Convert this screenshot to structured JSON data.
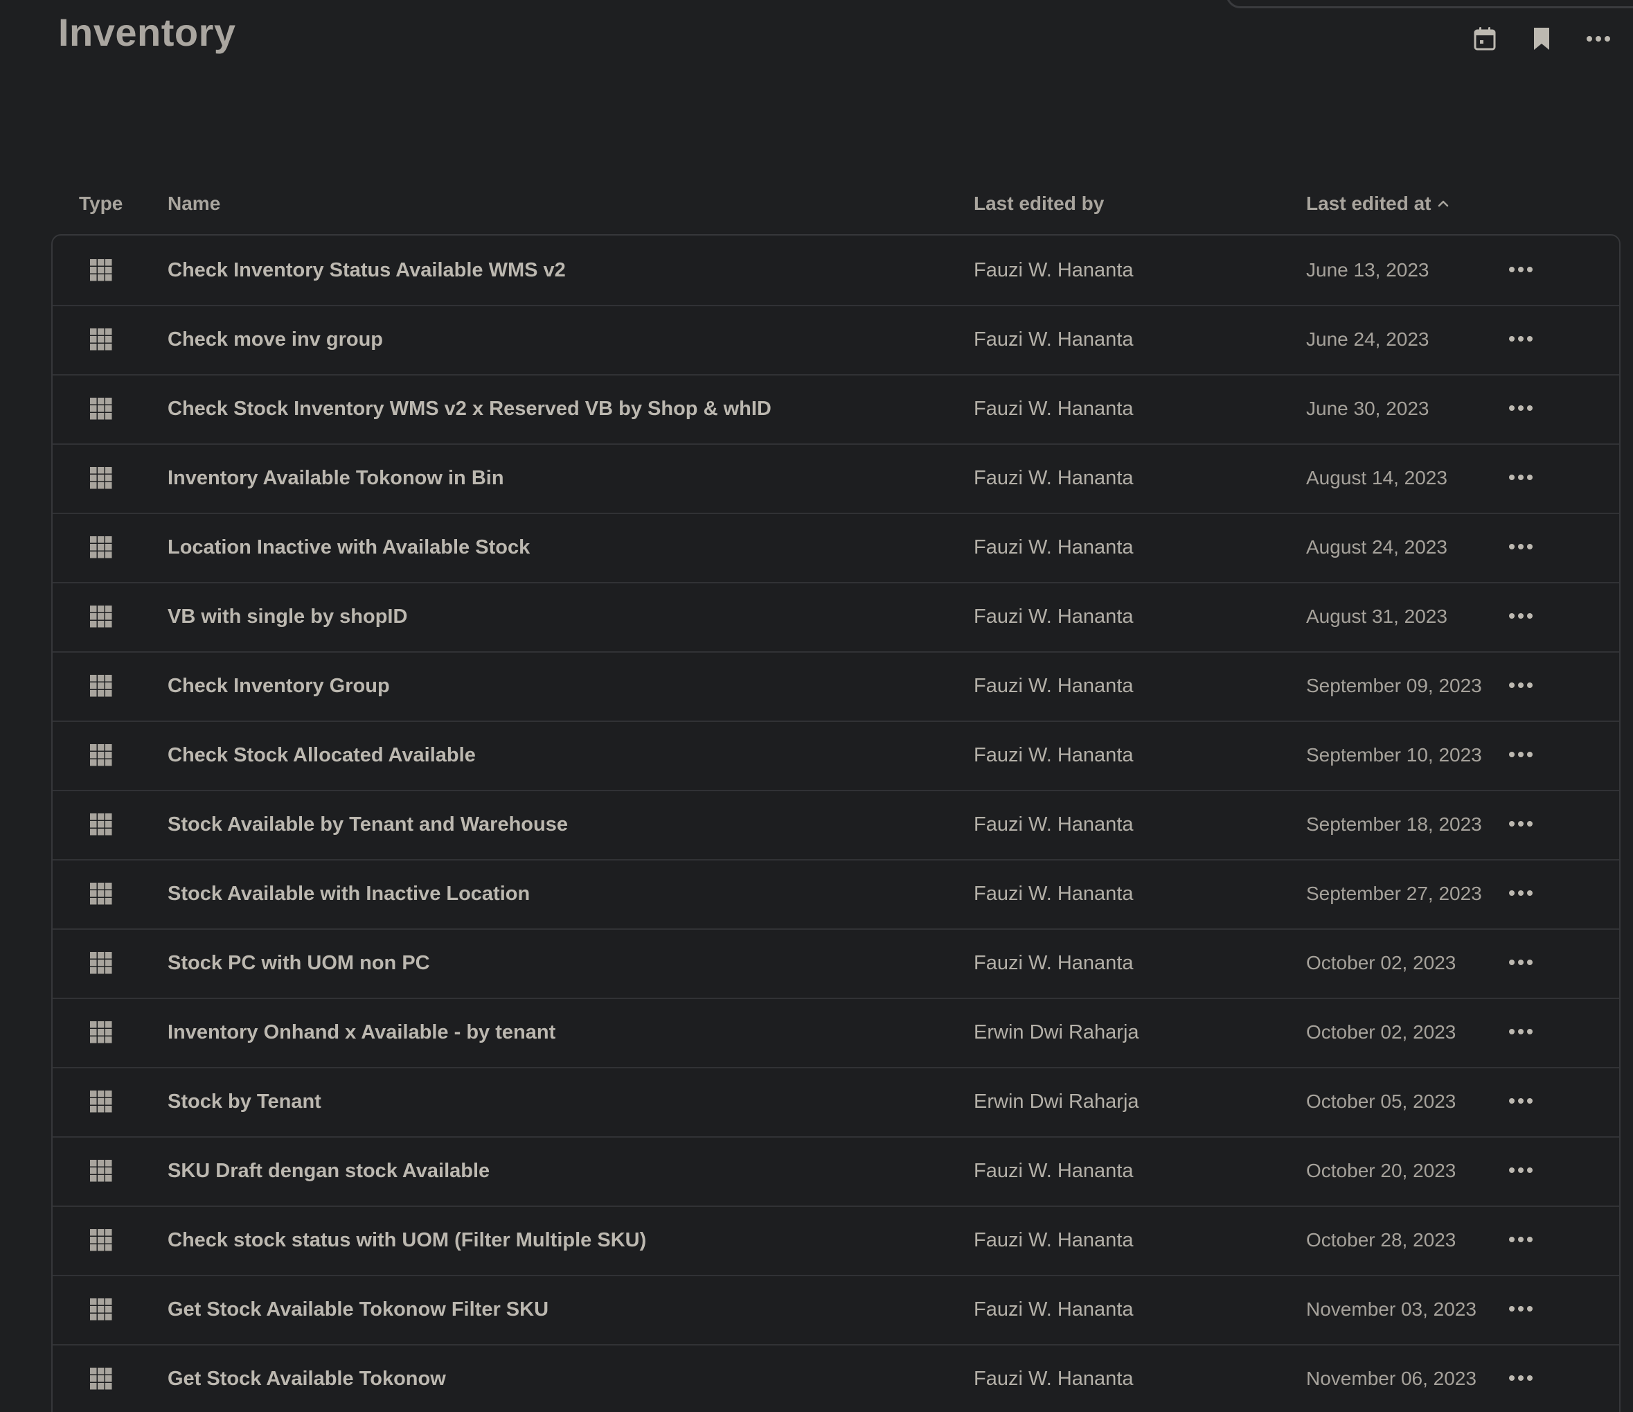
{
  "header": {
    "title": "Inventory",
    "actions": [
      {
        "name": "calendar-icon"
      },
      {
        "name": "bookmark-icon"
      },
      {
        "name": "more-horizontal-icon"
      }
    ]
  },
  "table": {
    "columns": {
      "type": "Type",
      "name": "Name",
      "editor": "Last edited by",
      "date": "Last edited at",
      "sort_indicator": "^"
    },
    "rows": [
      {
        "name": "Check Inventory Status Available WMS v2",
        "editor": "Fauzi W. Hananta",
        "date": "June 13, 2023"
      },
      {
        "name": "Check move inv group",
        "editor": "Fauzi W. Hananta",
        "date": "June 24, 2023"
      },
      {
        "name": "Check Stock Inventory WMS v2 x Reserved VB by Shop & whID",
        "editor": "Fauzi W. Hananta",
        "date": "June 30, 2023"
      },
      {
        "name": "Inventory Available Tokonow in Bin",
        "editor": "Fauzi W. Hananta",
        "date": "August 14, 2023"
      },
      {
        "name": "Location Inactive with Available Stock",
        "editor": "Fauzi W. Hananta",
        "date": "August 24, 2023"
      },
      {
        "name": "VB with single by shopID",
        "editor": "Fauzi W. Hananta",
        "date": "August 31, 2023"
      },
      {
        "name": "Check Inventory Group",
        "editor": "Fauzi W. Hananta",
        "date": "September 09, 2023"
      },
      {
        "name": "Check Stock Allocated Available",
        "editor": "Fauzi W. Hananta",
        "date": "September 10, 2023"
      },
      {
        "name": "Stock Available by Tenant and Warehouse",
        "editor": "Fauzi W. Hananta",
        "date": "September 18, 2023"
      },
      {
        "name": "Stock Available with Inactive Location",
        "editor": "Fauzi W. Hananta",
        "date": "September 27, 2023"
      },
      {
        "name": "Stock PC with UOM non PC",
        "editor": "Fauzi W. Hananta",
        "date": "October 02, 2023"
      },
      {
        "name": "Inventory Onhand x Available - by tenant",
        "editor": "Erwin Dwi Raharja",
        "date": "October 02, 2023"
      },
      {
        "name": "Stock by Tenant",
        "editor": "Erwin Dwi Raharja",
        "date": "October 05, 2023"
      },
      {
        "name": "SKU Draft dengan stock Available",
        "editor": "Fauzi W. Hananta",
        "date": "October 20, 2023"
      },
      {
        "name": "Check stock status with UOM (Filter Multiple SKU)",
        "editor": "Fauzi W. Hananta",
        "date": "October 28, 2023"
      },
      {
        "name": "Get Stock Available Tokonow Filter SKU",
        "editor": "Fauzi W. Hananta",
        "date": "November 03, 2023"
      },
      {
        "name": "Get Stock Available Tokonow",
        "editor": "Fauzi W. Hananta",
        "date": "November 06, 2023"
      }
    ],
    "row_icon": "table-grid-icon",
    "row_action_icon": "more-horizontal-icon"
  }
}
